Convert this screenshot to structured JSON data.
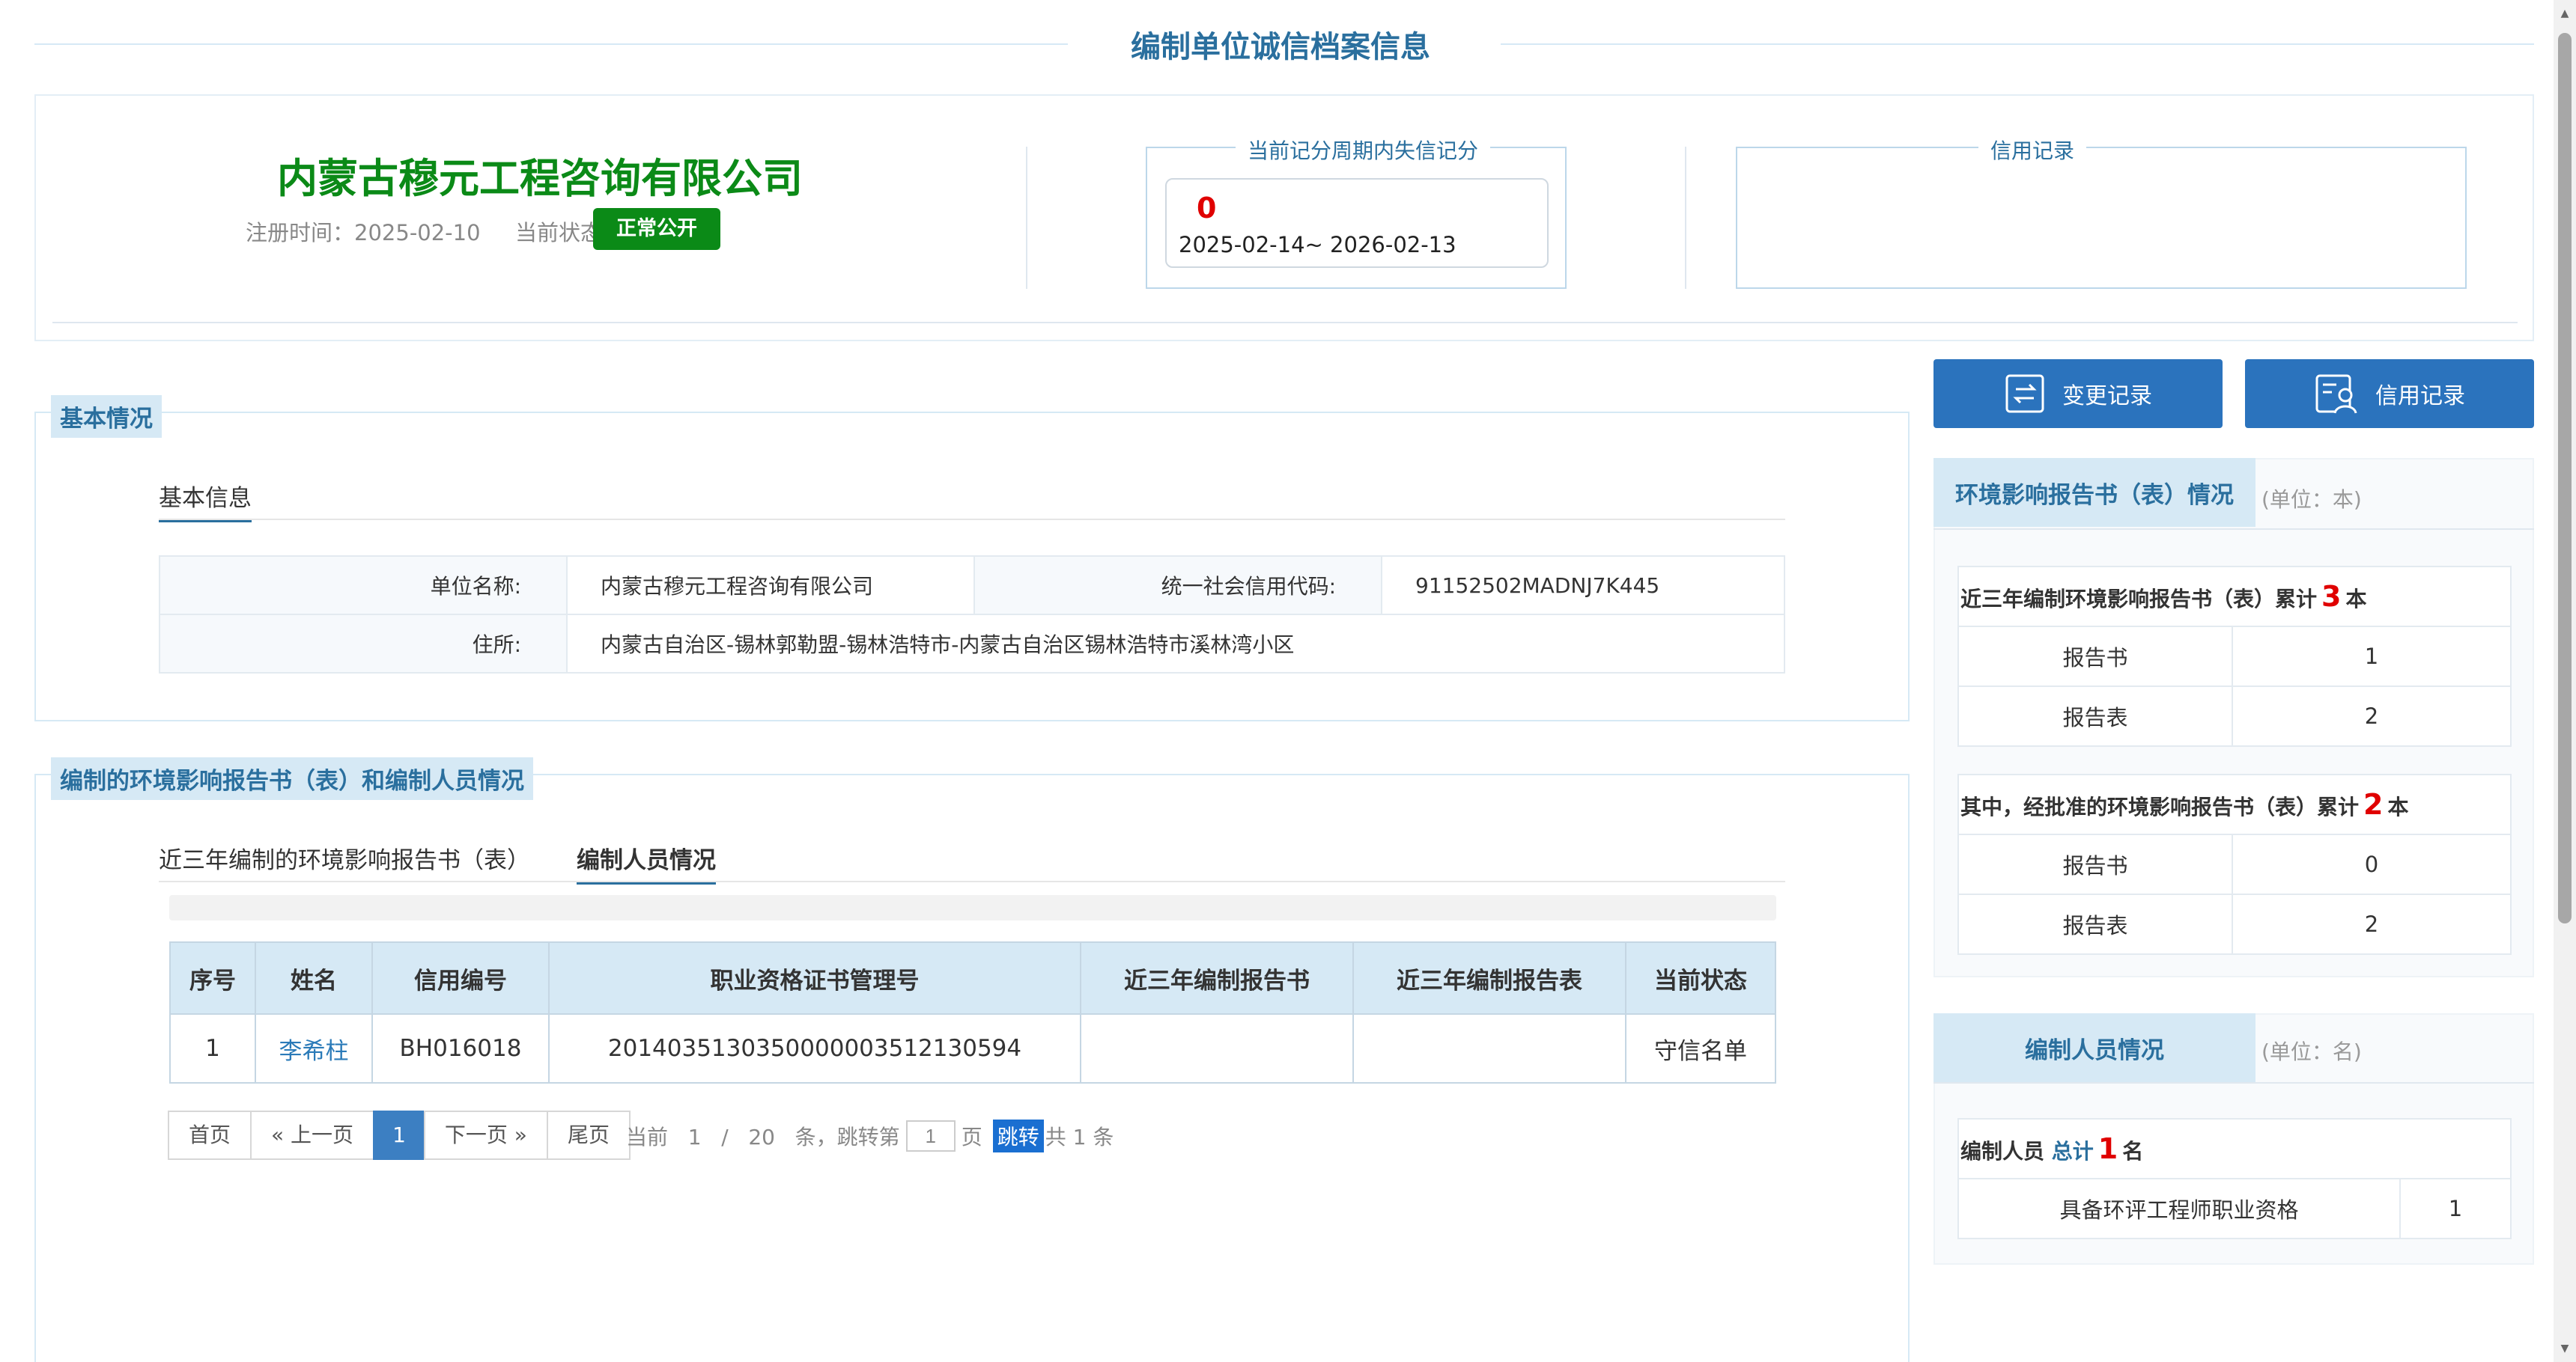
{
  "page": {
    "title": "编制单位诚信档案信息"
  },
  "summary": {
    "company_name": "内蒙古穆元工程咨询有限公司",
    "reg_label": "注册时间：",
    "reg_date": "2025-02-10",
    "status_label": "当前状态：",
    "status": "正常公开",
    "score_legend": "当前记分周期内失信记分",
    "score": "0",
    "period": "2025-02-14~ 2026-02-13",
    "credit_legend": "信用记录"
  },
  "basic": {
    "section_title": "基本情况",
    "tab": "基本信息",
    "unit_name_label": "单位名称:",
    "unit_name": "内蒙古穆元工程咨询有限公司",
    "credit_code_label": "统一社会信用代码:",
    "credit_code": "91152502MADNJ7K445",
    "address_label": "住所:",
    "address": "内蒙古自治区-锡林郭勒盟-锡林浩特市-内蒙古自治区锡林浩特市溪林湾小区"
  },
  "reports": {
    "section_title": "编制的环境影响报告书（表）和编制人员情况",
    "tabs": [
      "近三年编制的环境影响报告书（表）",
      "编制人员情况"
    ],
    "columns": [
      "序号",
      "姓名",
      "信用编号",
      "职业资格证书管理号",
      "近三年编制报告书",
      "近三年编制报告表",
      "当前状态"
    ],
    "rows": [
      {
        "index": "1",
        "name": "李希柱",
        "credit_no": "BH016018",
        "cert_no": "2014035130350000003512130594",
        "books": "",
        "forms": "",
        "status": "守信名单"
      }
    ]
  },
  "pager": {
    "first": "首页",
    "prev": "« 上一页",
    "current": "1",
    "next": "下一页 »",
    "last": "尾页",
    "info_prefix": "当前   1   /   20   条，跳转第",
    "jump_value": "1",
    "info_page": "页",
    "jump_btn": "跳转",
    "total": "共 1 条"
  },
  "right": {
    "change_btn": "变更记录",
    "credit_btn": "信用记录",
    "report_head": "环境影响报告书（表）情况",
    "unit_ben": "(单位：本)",
    "total_caption_pre": "近三年编制环境影响报告书（表）累计",
    "total_count": "3",
    "unit_word": "本",
    "book_label": "报告书",
    "form_label": "报告表",
    "total_books": "1",
    "total_forms": "2",
    "approved_caption_pre": "其中，经批准的环境影响报告书（表）累计",
    "approved_count": "2",
    "approved_books": "0",
    "approved_forms": "2",
    "staff_head": "编制人员情况",
    "unit_ming": "(单位：名)",
    "staff_caption_pre": "编制人员",
    "staff_total_word": "总计",
    "staff_count": "1",
    "staff_unit": "名",
    "qual_label": "具备环评工程师职业资格",
    "qual_count": "1"
  },
  "icons": {
    "change": "swap-document-icon",
    "credit": "person-card-icon"
  },
  "colors": {
    "accent": "#2a6f9e",
    "brand_green": "#0b8a17",
    "button_blue": "#2b73bd",
    "alert_red": "#e00000"
  }
}
